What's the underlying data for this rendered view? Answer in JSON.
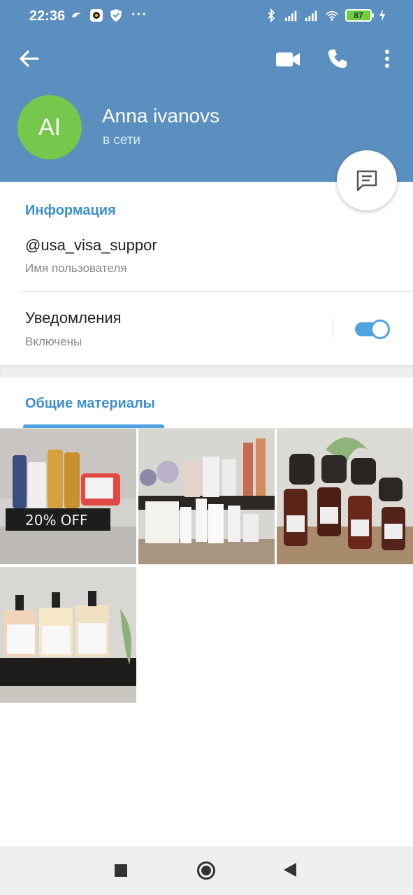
{
  "status_bar": {
    "time": "22:36",
    "dots": "···",
    "battery": "87",
    "icons": [
      "cloud-icon",
      "app-icon",
      "shield-icon",
      "bluetooth-icon",
      "signal-icon",
      "signal-r-icon",
      "wifi-icon",
      "charging-icon"
    ]
  },
  "header": {
    "avatar_initials": "AI",
    "name": "Anna ivanovs",
    "status": "в сети",
    "actions": [
      "back-arrow-icon",
      "video-call-icon",
      "phone-icon",
      "more-vertical-icon"
    ]
  },
  "info": {
    "title": "Информация",
    "username": "@usa_visa_suppor",
    "username_caption": "Имя пользователя",
    "notifications_label": "Уведомления",
    "notifications_state": "Включены",
    "notifications_on": true
  },
  "media": {
    "tab_title": "Общие материалы",
    "thumbnails": [
      {
        "name": "media-thumb-1",
        "caption": "20% OFF"
      },
      {
        "name": "media-thumb-2"
      },
      {
        "name": "media-thumb-3"
      },
      {
        "name": "media-thumb-4"
      }
    ]
  },
  "colors": {
    "header": "#5a8fc0",
    "avatar": "#76c84d",
    "accent": "#3d8fd0",
    "toggle": "#4fa3e0"
  }
}
